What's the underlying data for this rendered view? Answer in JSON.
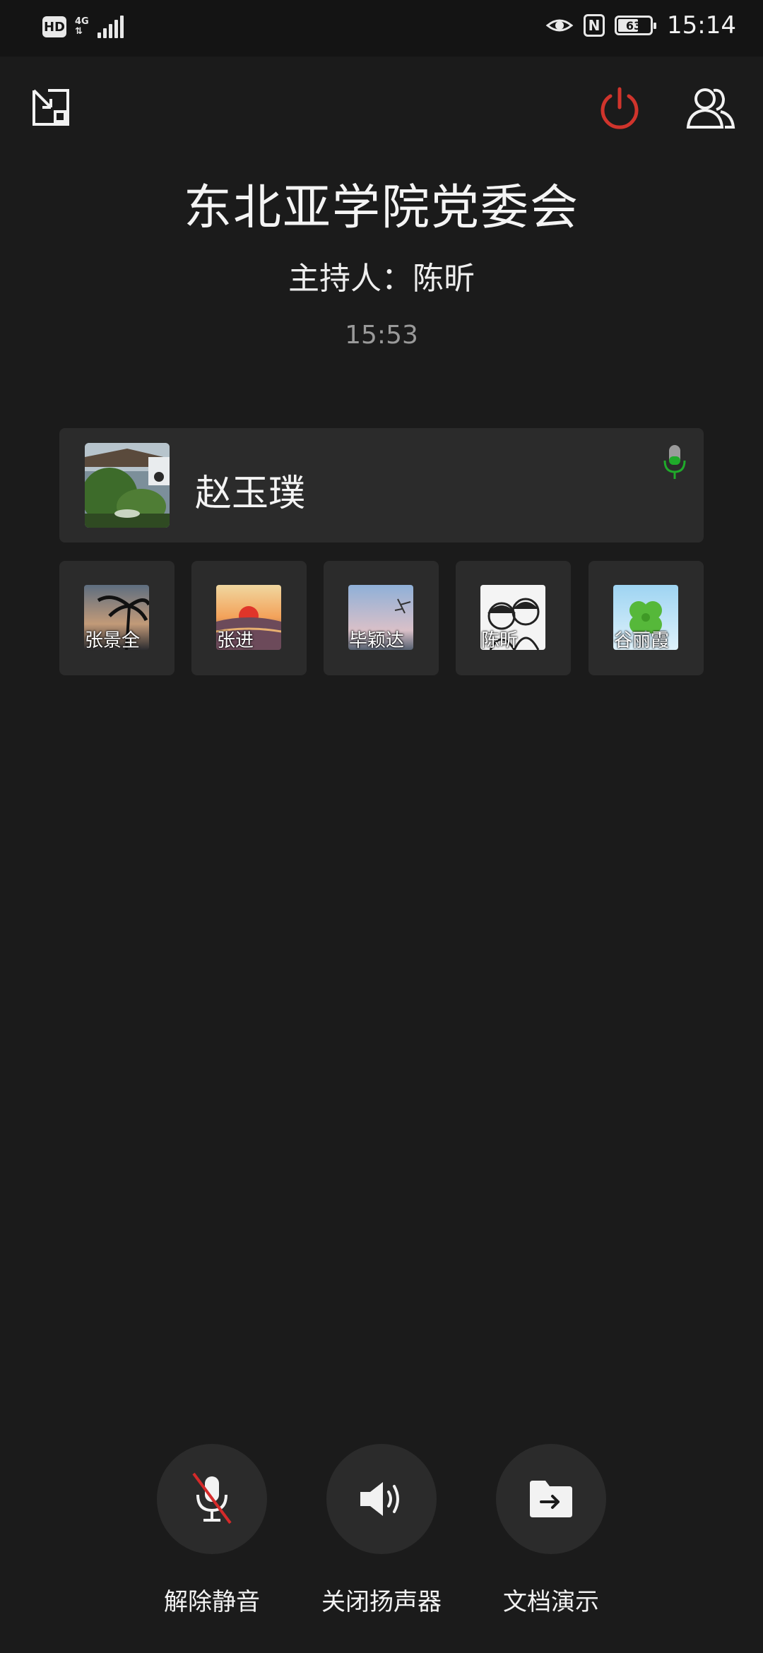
{
  "status_bar": {
    "hd": "HD",
    "network": "4G",
    "battery": "63",
    "battery_level": 0.63,
    "time": "15:14"
  },
  "meeting": {
    "title": "东北亚学院党委会",
    "host": "主持人：陈昕",
    "duration": "15:53"
  },
  "active_speaker": {
    "name": "赵玉璞",
    "mic_color": "#1faa2a"
  },
  "participants": [
    {
      "name": "张景全"
    },
    {
      "name": "张进"
    },
    {
      "name": "毕颖达"
    },
    {
      "name": "陈昕"
    },
    {
      "name": "谷丽霞"
    }
  ],
  "controls": {
    "unmute": "解除静音",
    "speaker_off": "关闭扬声器",
    "share_doc": "文档演示"
  },
  "colors": {
    "background": "#1b1b1b",
    "card": "#2b2b2b",
    "power_red": "#d0342c",
    "mute_slash": "#d42a2a"
  }
}
